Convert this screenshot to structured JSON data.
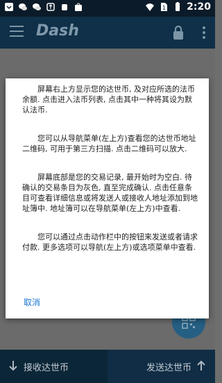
{
  "status_bar": {
    "time": "2:20"
  },
  "app_bar": {
    "logo_text": "Dash"
  },
  "dialog": {
    "paragraphs": [
      "屏幕右上方显示您的达世币, 及对应所选的法币余额.        点击进入法币列表, 点击其中一种将其设为默认法币.",
      "您可以从导航菜单(左上方)查看您的达世币地址二维码, 可用于第三方扫描.           点击二维码可以放大.",
      "屏幕底部是您的交易记录, 最开始时为空白.        待确认的交易条目为灰色, 直至完成确认.           点击任意条目可查看详细信息或将发送人或接收人地址添加到地址簿中.        地址簿可以在导航菜单(左上方)中查看.",
      "您可以通过点击动作栏中的按钮来发送或者请求付款.        更多选项可以导航(左上方)或选项菜单中查看."
    ],
    "cancel_label": "取消"
  },
  "bottom_bar": {
    "receive_label": "接收达世币",
    "send_label": "发送达世币"
  },
  "colors": {
    "accent": "#1a75d2",
    "app_bar": "#0f3048",
    "status_bar": "#0b1b29"
  }
}
